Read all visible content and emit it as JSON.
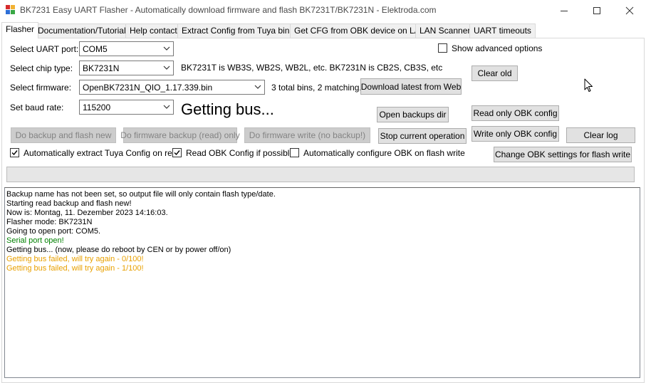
{
  "window": {
    "title": "BK7231 Easy UART Flasher - Automatically download firmware and flash BK7231T/BK7231N  - Elektroda.com"
  },
  "tabs": [
    {
      "label": "Flasher"
    },
    {
      "label": "Documentation/Tutorials"
    },
    {
      "label": "Help contact"
    },
    {
      "label": "Extract Config from Tuya binary"
    },
    {
      "label": "Get CFG from OBK device on LAN"
    },
    {
      "label": "LAN Scanner"
    },
    {
      "label": "UART timeouts"
    }
  ],
  "form": {
    "uart_label": "Select UART port:",
    "uart_value": "COM5",
    "chip_label": "Select chip type:",
    "chip_value": "BK7231N",
    "chip_info": "BK7231T is WB3S, WB2S, WB2L, etc. BK7231N is CB2S, CB3S, etc",
    "firmware_label": "Select firmware:",
    "firmware_value": "OpenBK7231N_QIO_1.17.339.bin",
    "firmware_info": "3 total bins, 2 matching.",
    "baud_label": "Set baud rate:",
    "baud_value": "115200",
    "status_text": "Getting bus...",
    "show_advanced_label": "Show advanced options"
  },
  "buttons": {
    "download_latest": "Download latest from Web",
    "clear_old": "Clear old",
    "open_backups_dir": "Open backups dir",
    "read_only_obk": "Read only OBK config",
    "write_only_obk": "Write only OBK config",
    "clear_log": "Clear log",
    "do_backup_and_flash": "Do backup and flash new",
    "do_firmware_backup": "Do firmware backup (read) only",
    "do_firmware_write": "Do firmware write (no backup!)",
    "stop_operation": "Stop current operation",
    "change_obk_settings": "Change OBK settings for flash write"
  },
  "checkboxes": {
    "auto_extract_tuya": {
      "label": "Automatically extract Tuya Config on read",
      "checked": true
    },
    "read_obk_config": {
      "label": "Read OBK Config if possible",
      "checked": true
    },
    "auto_configure_obk": {
      "label": "Automatically configure OBK on flash write",
      "checked": false
    },
    "show_advanced": {
      "checked": false
    }
  },
  "log": {
    "lines": [
      {
        "text": "Backup name has not been set, so output file will only contain flash type/date.",
        "color": "#000000"
      },
      {
        "text": "Starting read backup and flash new!",
        "color": "#000000"
      },
      {
        "text": "Now is: Montag, 11. Dezember 2023 14:16:03.",
        "color": "#000000"
      },
      {
        "text": "Flasher mode: BK7231N",
        "color": "#000000"
      },
      {
        "text": "Going to open port: COM5.",
        "color": "#000000"
      },
      {
        "text": "Serial port open!",
        "color": "#008000"
      },
      {
        "text": "Getting bus... (now, please do reboot by CEN or by power off/on)",
        "color": "#000000"
      },
      {
        "text": "Getting bus failed, will try again - 0/100!",
        "color": "#e8a000"
      },
      {
        "text": "Getting bus failed, will try again - 1/100!",
        "color": "#e8a000"
      }
    ]
  }
}
